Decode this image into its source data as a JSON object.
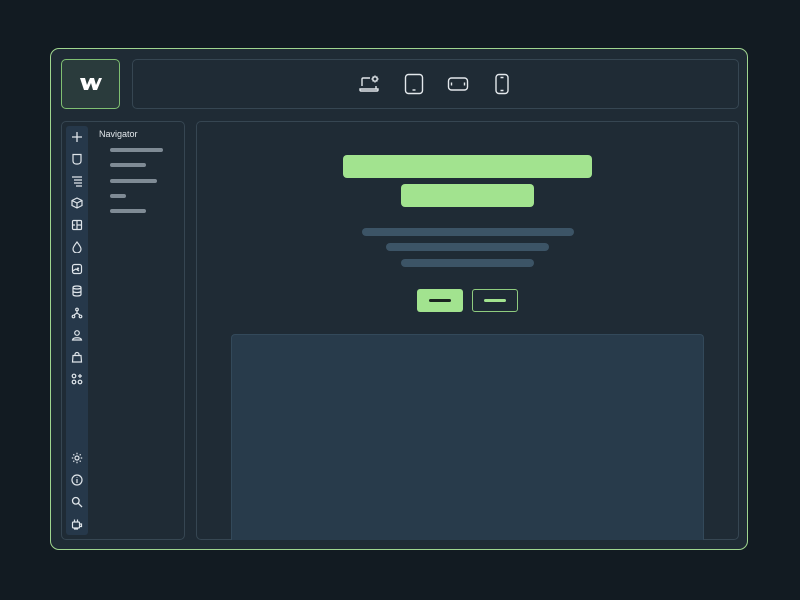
{
  "app": {
    "logo_text": "W"
  },
  "toolbar": {
    "devices": [
      {
        "name": "desktop-settings"
      },
      {
        "name": "tablet"
      },
      {
        "name": "mobile-landscape"
      },
      {
        "name": "mobile-portrait"
      }
    ]
  },
  "sidebar": {
    "panel_title": "Navigator",
    "rail_top_icons": [
      "add-icon",
      "pages-icon",
      "navigator-icon",
      "components-icon",
      "styles-icon",
      "drop-icon",
      "assets-icon",
      "cms-icon",
      "logic-icon",
      "users-icon",
      "ecommerce-icon",
      "apps-icon"
    ],
    "rail_bottom_icons": [
      "settings-icon",
      "info-icon",
      "search-icon",
      "plugin-icon"
    ]
  },
  "colors": {
    "accent": "#a2e38f",
    "background": "#121b22",
    "panel": "#1f2b35",
    "rail": "#26384a",
    "placeholder_text": "#3c5466"
  }
}
